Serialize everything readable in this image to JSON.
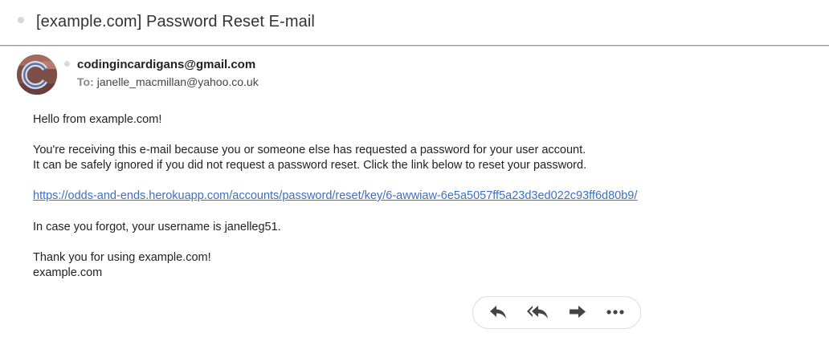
{
  "subject": "[example.com] Password Reset E-mail",
  "sender": {
    "email": "codingincardigans@gmail.com",
    "to_label": "To:",
    "to_email": "janelle_macmillan@yahoo.co.uk"
  },
  "body": {
    "greeting": "Hello from example.com!",
    "notice_line1": "You're receiving this e-mail because you or someone else has requested a password for your user account.",
    "notice_line2": "It can be safely ignored if you did not request a password reset. Click the link below to reset your password.",
    "reset_link": "https://odds-and-ends.herokuapp.com/accounts/password/reset/key/6-awwiaw-6e5a5057ff5a23d3ed022c93ff6d80b9/",
    "username_line": "In case you forgot, your username is janelleg51.",
    "thanks_line": "Thank you for using example.com!",
    "signature": "example.com"
  },
  "actions": {
    "icons": [
      "reply-icon",
      "reply-all-icon",
      "forward-icon",
      "more-icon"
    ]
  }
}
